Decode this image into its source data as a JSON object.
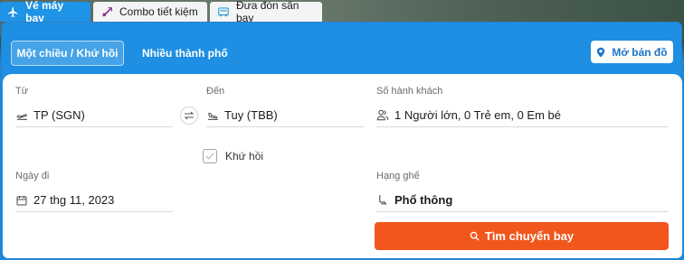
{
  "tabs": [
    {
      "label": "Vé máy bay",
      "icon": "airplane-icon",
      "active": true
    },
    {
      "label": "Combo tiết kiệm",
      "icon": "combo-ticket-icon",
      "active": false
    },
    {
      "label": "Đưa đón sân bay",
      "icon": "airport-transfer-icon",
      "active": false
    }
  ],
  "modes": {
    "one_way_round_trip": "Một chiều / Khứ hồi",
    "multi_city": "Nhiều thành phố"
  },
  "map_button": {
    "label": "Mở bản đồ",
    "icon": "map-pin-icon"
  },
  "form": {
    "from": {
      "label": "Từ",
      "value": "TP (SGN)",
      "icon": "plane-takeoff-icon"
    },
    "to": {
      "label": "Đến",
      "value": "Tuy (TBB)",
      "icon": "plane-landing-icon"
    },
    "passengers": {
      "label": "Số hành khách",
      "value": "1 Người lớn, 0 Trẻ em, 0 Em bé",
      "icon": "passengers-icon"
    },
    "round_trip": {
      "label": "Khứ hồi",
      "checked": false
    },
    "departure_date": {
      "label": "Ngày đi",
      "value": "27 thg 11, 2023",
      "icon": "calendar-icon"
    },
    "seat_class": {
      "label": "Hạng ghế",
      "value": "Phổ thông",
      "icon": "seat-icon"
    }
  },
  "search_button": {
    "label": "Tìm chuyến bay",
    "icon": "search-icon"
  },
  "colors": {
    "accent": "#1e8fe2",
    "cta": "#f1571d"
  }
}
